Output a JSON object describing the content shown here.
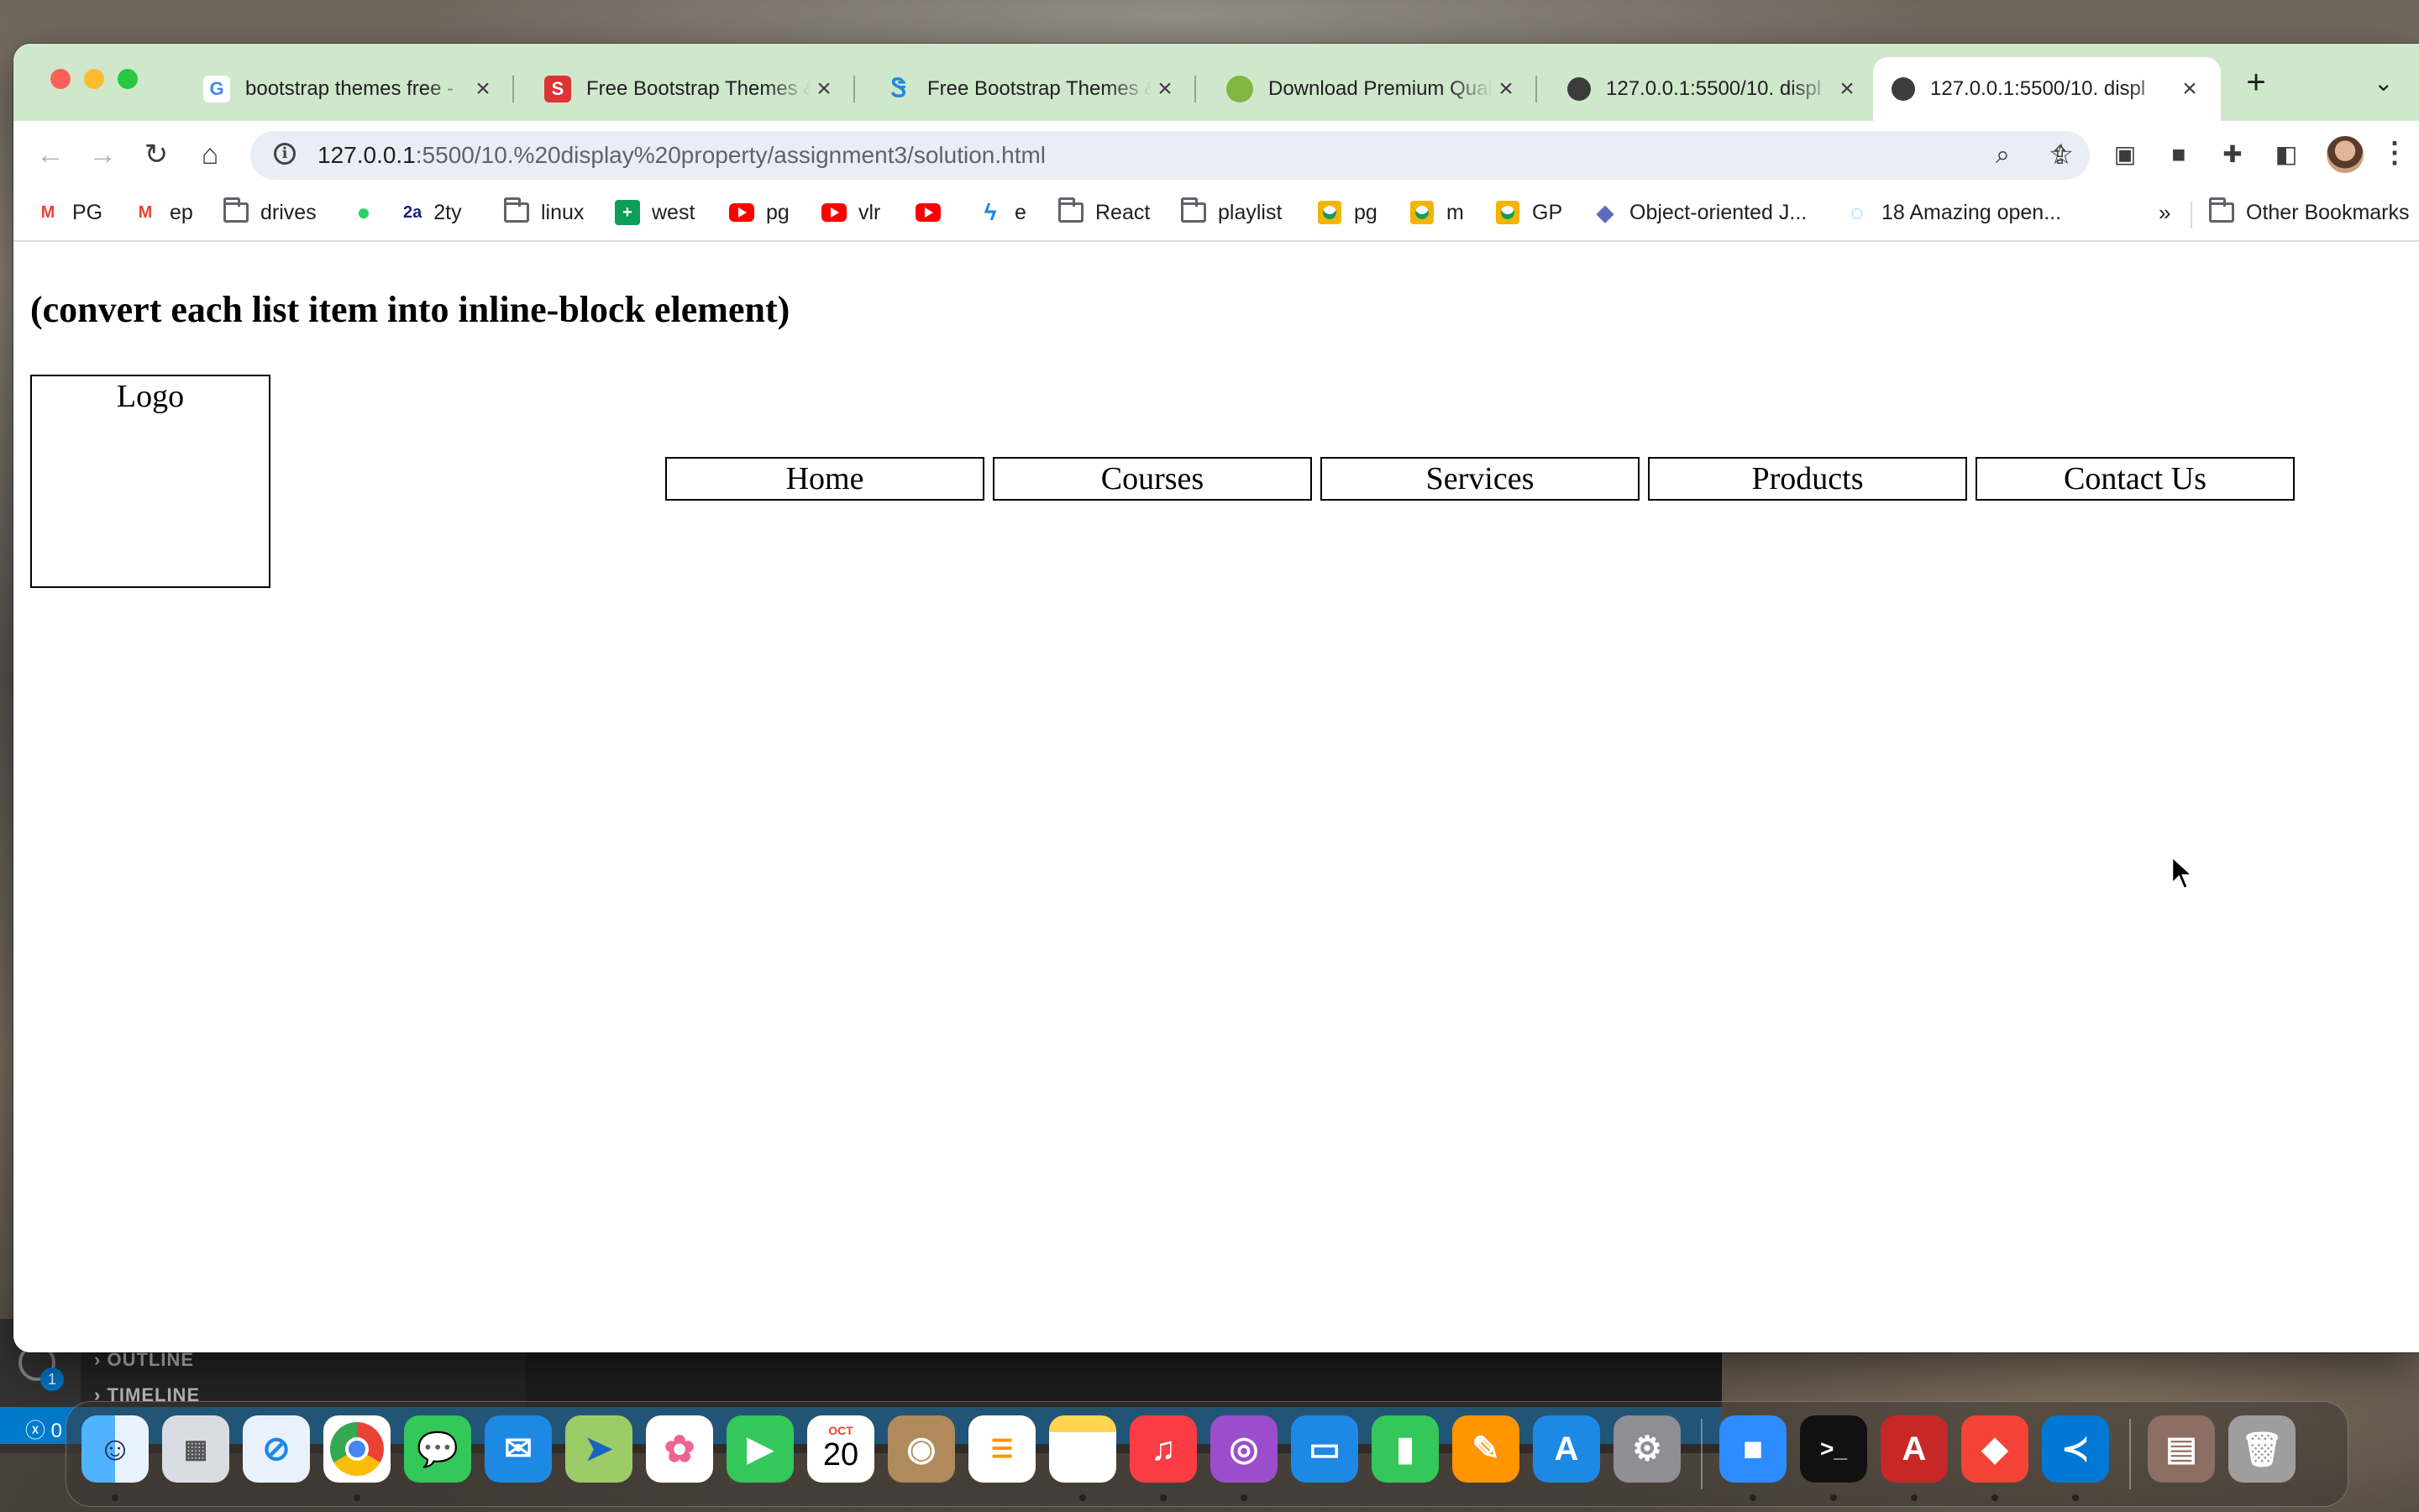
{
  "browser": {
    "tabs": [
      {
        "title": "bootstrap themes free -",
        "icon": "google-icon",
        "active": false
      },
      {
        "title": "Free Bootstrap Themes &",
        "icon": "startbootstrap-icon",
        "active": false
      },
      {
        "title": "Free Bootstrap Themes &",
        "icon": "bootstrapmade-icon",
        "active": false
      },
      {
        "title": "Download Premium Qual",
        "icon": "themeforest-icon",
        "active": false
      },
      {
        "title": "127.0.0.1:5500/10. displ",
        "icon": "globe-icon",
        "active": false
      },
      {
        "title": "127.0.0.1:5500/10. displ",
        "icon": "globe-icon",
        "active": true
      }
    ],
    "address_host": "127.0.0.1",
    "address_rest": ":5500/10.%20display%20property/assignment3/solution.html",
    "bookmarks": [
      {
        "label": "PG",
        "icon": "gmail-icon"
      },
      {
        "label": "ep",
        "icon": "gmail-icon"
      },
      {
        "label": "drives",
        "icon": "folder-icon"
      },
      {
        "label": "",
        "icon": "whatsapp-icon"
      },
      {
        "label": "2ty",
        "icon": "2a-icon"
      },
      {
        "label": "linux",
        "icon": "folder-icon"
      },
      {
        "label": "west",
        "icon": "sheets-icon"
      },
      {
        "label": "pg",
        "icon": "youtube-icon"
      },
      {
        "label": "vlr",
        "icon": "youtube-icon"
      },
      {
        "label": "",
        "icon": "youtube-icon"
      },
      {
        "label": "e",
        "icon": "bolt-icon"
      },
      {
        "label": "React",
        "icon": "folder-icon"
      },
      {
        "label": "playlist",
        "icon": "folder-icon"
      },
      {
        "label": "pg",
        "icon": "classroom-icon"
      },
      {
        "label": "m",
        "icon": "classroom-icon"
      },
      {
        "label": "GP",
        "icon": "classroom-icon"
      },
      {
        "label": "Object-oriented J...",
        "icon": "bird-icon"
      },
      {
        "label": "18 Amazing open...",
        "icon": "spinner-icon"
      }
    ],
    "bookmarks_overflow": "»",
    "other_bookmarks": "Other Bookmarks"
  },
  "page": {
    "heading": "(convert each list item into inline-block element)",
    "logo": "Logo",
    "nav": [
      "Home",
      "Courses",
      "Services",
      "Products",
      "Contact Us"
    ]
  },
  "vscode": {
    "outline": "OUTLINE",
    "timeline": "TIMELINE",
    "badge": "1",
    "status_errors": "0"
  },
  "dock": {
    "calendar_month": "OCT",
    "calendar_day": "20"
  },
  "colors": {
    "tabstrip": "#cfe8cc",
    "omnibox": "#e9eef6"
  }
}
